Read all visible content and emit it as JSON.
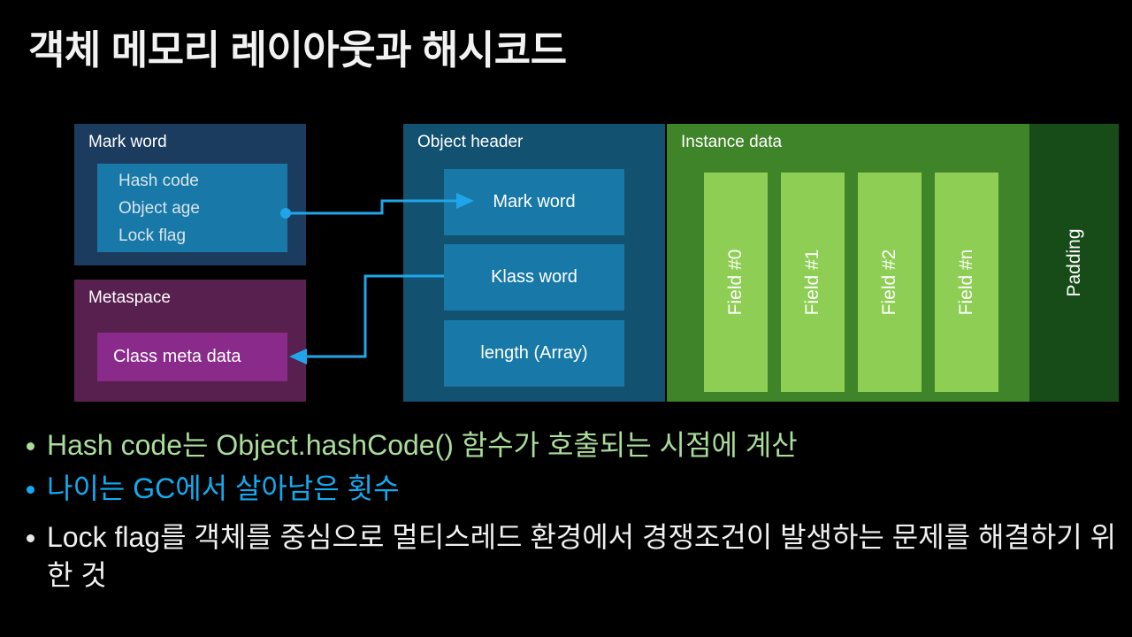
{
  "slide": {
    "title": "객체 메모리 레이아웃과 해시코드",
    "background_color": "#000000",
    "title_color": "#f2f2f2"
  },
  "diagram": {
    "mark_word_panel": {
      "label": "Mark word",
      "panel_color": "#1b3b5f",
      "inner_box_color": "#1879a8",
      "fields": [
        "Hash code",
        "Object age",
        "Lock flag"
      ]
    },
    "metaspace_panel": {
      "label": "Metaspace",
      "panel_color": "#58204f",
      "inner_box_color": "#8a2a8a",
      "inner_label": "Class meta data"
    },
    "object_header_panel": {
      "label": "Object header",
      "panel_color": "#125170",
      "slot_color": "#1879a8",
      "slots": [
        "Mark word",
        "Klass word",
        "length (Array)"
      ]
    },
    "instance_data_panel": {
      "label": "Instance data",
      "panel_color": "#3f8428",
      "field_box_color": "#8ece54",
      "fields": [
        "Field #0",
        "Field #1",
        "Field #2",
        "Field #n"
      ]
    },
    "padding_panel": {
      "label": "Padding",
      "panel_color": "#174c19"
    },
    "connectors": {
      "color": "#20a6e8",
      "items": [
        {
          "name": "hash-code-to-mark-word",
          "from": "Mark word fields box",
          "to": "Object header / Mark word slot",
          "start_marker": "dot",
          "end_marker": "arrow"
        },
        {
          "name": "klass-word-to-class-meta-data",
          "from": "Object header / Klass word slot",
          "to": "Metaspace / Class meta data",
          "start_marker": "none",
          "end_marker": "arrow"
        }
      ]
    }
  },
  "bullets": [
    {
      "text": "Hash code는 Object.hashCode() 함수가 호출되는 시점에 계산",
      "color": "#a9dd9a"
    },
    {
      "text": "나이는 GC에서 살아남은 횟수",
      "color": "#13aaf0"
    },
    {
      "text": "Lock flag를 객체를 중심으로 멀티스레드 환경에서 경쟁조건이 발생하는 문제를 해결하기 위한 것",
      "color": "#f0f0f0"
    }
  ]
}
